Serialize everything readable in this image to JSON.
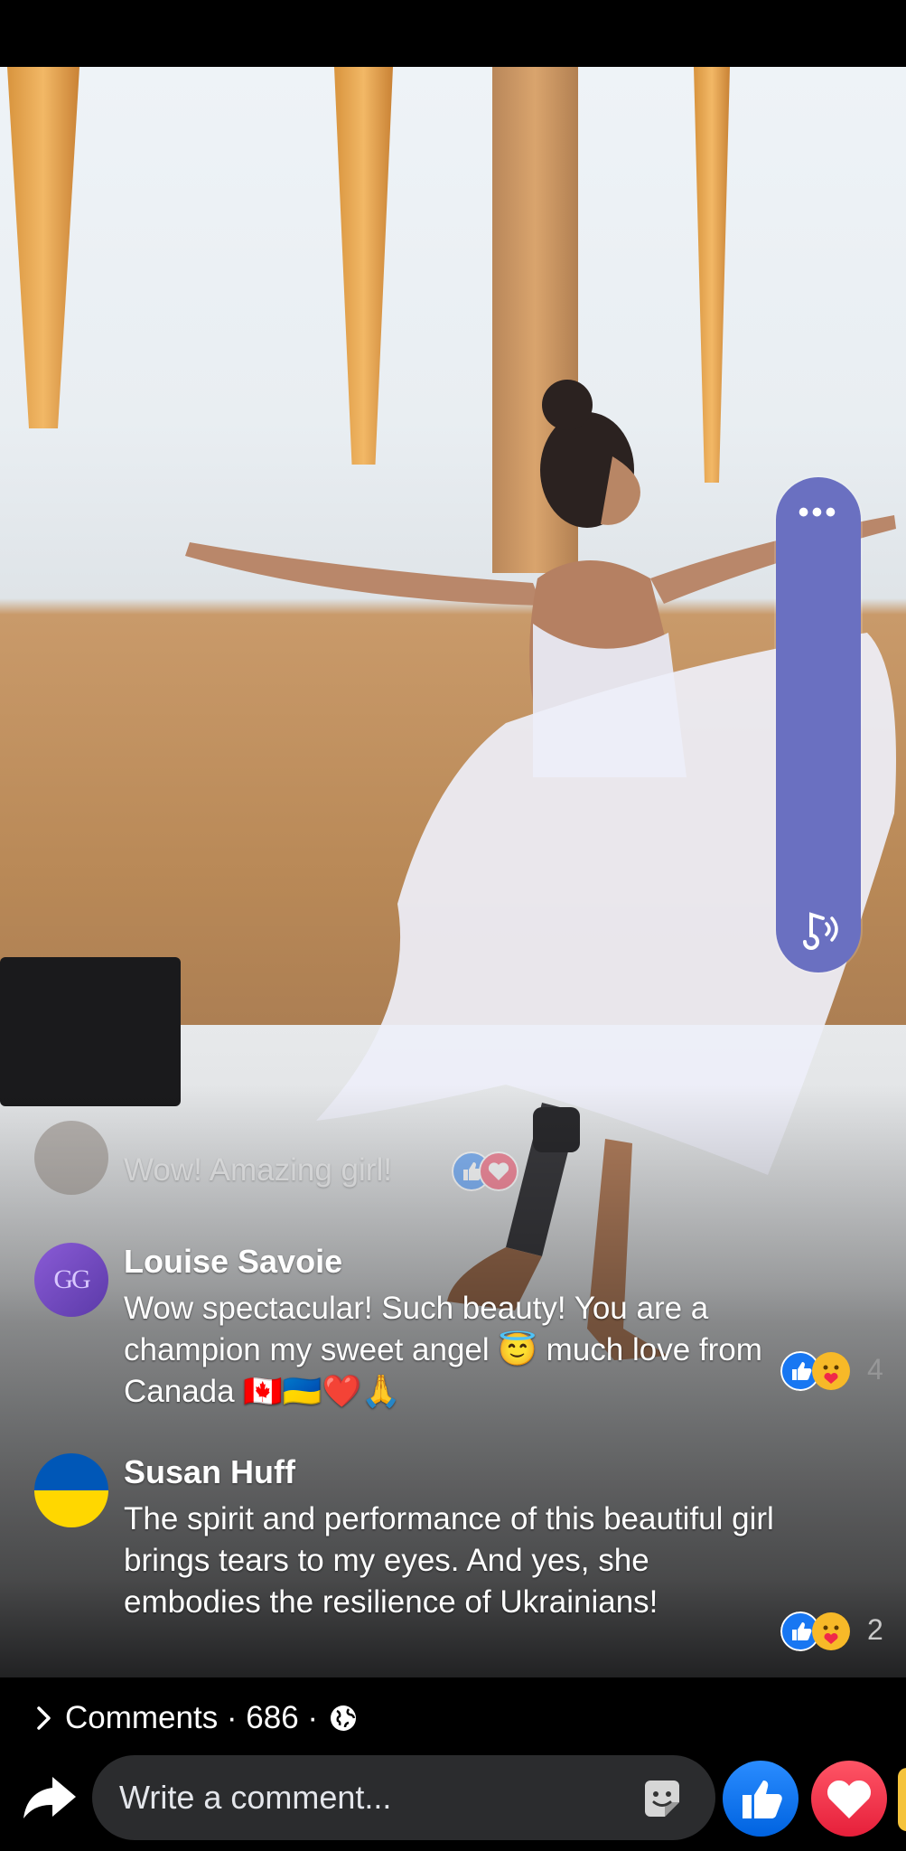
{
  "video": {
    "comments": [
      {
        "name": "",
        "text": "Wow! Amazing girl!",
        "faded": true
      },
      {
        "name": "Louise Savoie",
        "text": "Wow spectacular! Such beauty! You are a champion my sweet angel 😇 much love from Canada 🇨🇦🇺🇦❤️🙏",
        "avatar_text": "GG",
        "reaction_count": "4"
      },
      {
        "name": "Susan Huff",
        "text": "The spirit and performance of this beautiful girl brings tears to my eyes. And yes, she embodies the resilience of Ukrainians!",
        "reaction_count": "2"
      }
    ],
    "side_panel": {
      "dots": "•••",
      "icon": "music-sound-icon"
    }
  },
  "footer": {
    "comments_summary": "Comments · 686 ·",
    "input_placeholder": "Write a comment...",
    "icons": [
      "chevron-right-icon",
      "globe-icon",
      "share-icon",
      "sticker-icon",
      "like-icon",
      "love-icon"
    ]
  },
  "colors": {
    "side_panel": "#6a70c1",
    "like_blue": "#1877f2",
    "love_red": "#f02849",
    "input_bg": "#2b2c2e"
  }
}
